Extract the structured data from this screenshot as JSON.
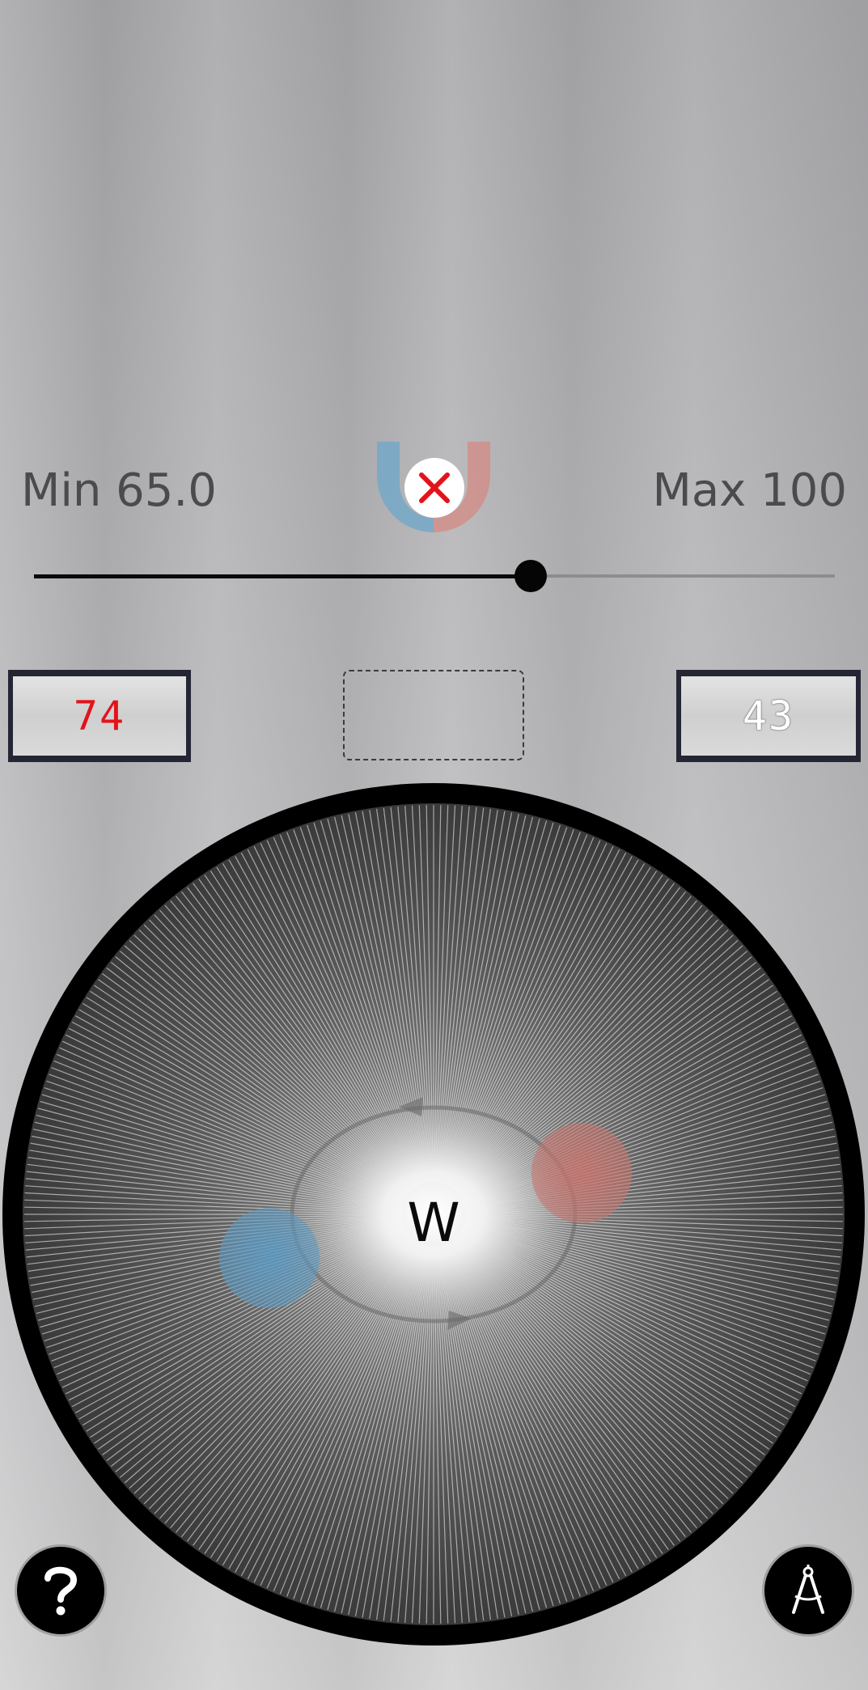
{
  "range": {
    "min_label": "Min 65.0",
    "max_label": "Max 100",
    "slider_value": 0.62
  },
  "readouts": {
    "left_value": "74",
    "right_value": "43",
    "center_value": ""
  },
  "dial": {
    "direction_label": "W"
  },
  "icons": {
    "magnet": "magnet-icon",
    "close": "close-icon",
    "help": "help-icon",
    "compass": "compass-icon"
  },
  "colors": {
    "magnet_blue": "#74a8c8",
    "magnet_red": "#d08f8a",
    "close_red": "#e3131b",
    "lcd_left_text": "#e3131b",
    "lcd_frame": "#252634"
  }
}
